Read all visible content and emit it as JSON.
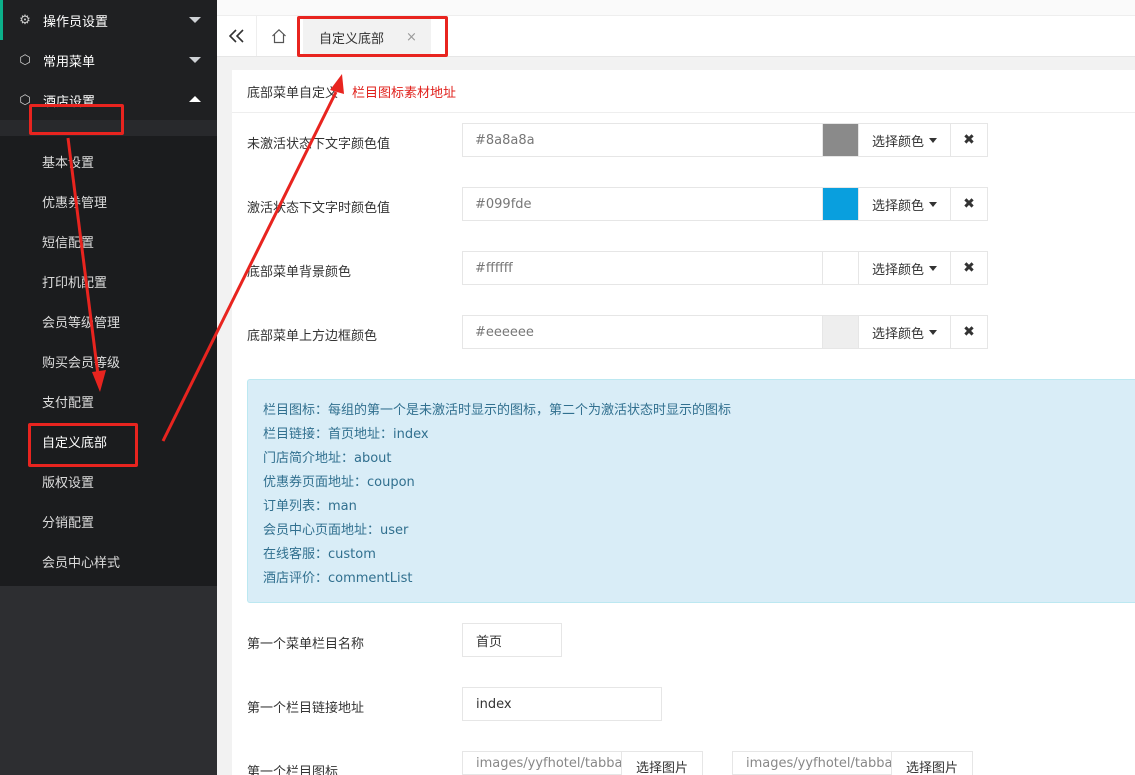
{
  "sidebar": {
    "groups": [
      {
        "label": "操作员设置",
        "icon": "gear-icon"
      },
      {
        "label": "常用菜单",
        "icon": "cube-icon"
      },
      {
        "label": "酒店设置",
        "icon": "cube-icon"
      }
    ],
    "sub_items": [
      "基本设置",
      "优惠券管理",
      "短信配置",
      "打印机配置",
      "会员等级管理",
      "购买会员等级",
      "支付配置",
      "自定义底部",
      "版权设置",
      "分销配置",
      "会员中心样式"
    ]
  },
  "tabs": {
    "active_label": "自定义底部",
    "close_glyph": "×"
  },
  "card": {
    "title": "底部菜单自定义",
    "link": "栏目图标素材地址"
  },
  "color_rows": [
    {
      "label": "未激活状态下文字颜色值",
      "value": "#8a8a8a",
      "swatch": "#8a8a8a"
    },
    {
      "label": "激活状态下文字时颜色值",
      "value": "#099fde",
      "swatch": "#099fde"
    },
    {
      "label": "底部菜单背景颜色",
      "value": "#ffffff",
      "swatch": "#ffffff"
    },
    {
      "label": "底部菜单上方边框颜色",
      "value": "#eeeeee",
      "swatch": "#eeeeee"
    }
  ],
  "pick_color_label": "选择颜色",
  "clear_glyph": "✖",
  "info_lines": [
    "栏目图标：每组的第一个是未激活时显示的图标，第二个为激活状态时显示的图标",
    "栏目链接：首页地址：index",
    "门店简介地址：about",
    "优惠券页面地址：coupon",
    "订单列表：man",
    "会员中心页面地址：user",
    "在线客服：custom",
    "酒店评价：commentList"
  ],
  "fields": {
    "menu1_name_label": "第一个菜单栏目名称",
    "menu1_name_value": "首页",
    "menu1_link_label": "第一个栏目链接地址",
    "menu1_link_value": "index",
    "menu1_icon_label": "第一个栏目图标",
    "icon_path_1": "images/yyfhotel/tabbar/",
    "icon_path_2": "images/yyfhotel/tabbar/",
    "choose_image_label": "选择图片"
  }
}
